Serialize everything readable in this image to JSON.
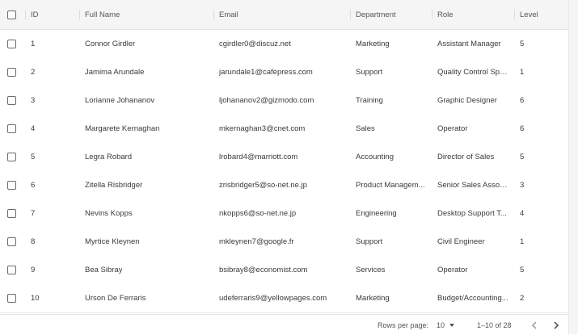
{
  "columns": {
    "id": "ID",
    "name": "Full Name",
    "email": "Email",
    "department": "Department",
    "role": "Role",
    "level": "Level"
  },
  "rows": [
    {
      "id": "1",
      "name": "Connor Girdler",
      "email": "cgirdler0@discuz.net",
      "department": "Marketing",
      "role": "Assistant Manager",
      "level": "5"
    },
    {
      "id": "2",
      "name": "Jamima Arundale",
      "email": "jarundale1@cafepress.com",
      "department": "Support",
      "role": "Quality Control Spe...",
      "level": "1"
    },
    {
      "id": "3",
      "name": "Lorianne Johananov",
      "email": "ljohananov2@gizmodo.com",
      "department": "Training",
      "role": "Graphic Designer",
      "level": "6"
    },
    {
      "id": "4",
      "name": "Margarete Kernaghan",
      "email": "mkernaghan3@cnet.com",
      "department": "Sales",
      "role": "Operator",
      "level": "6"
    },
    {
      "id": "5",
      "name": "Legra Robard",
      "email": "lrobard4@marriott.com",
      "department": "Accounting",
      "role": "Director of Sales",
      "level": "5"
    },
    {
      "id": "6",
      "name": "Zitella Risbridger",
      "email": "zrisbridger5@so-net.ne.jp",
      "department": "Product Managem...",
      "role": "Senior Sales Associ...",
      "level": "3"
    },
    {
      "id": "7",
      "name": "Nevins Kopps",
      "email": "nkopps6@so-net.ne.jp",
      "department": "Engineering",
      "role": "Desktop Support T...",
      "level": "4"
    },
    {
      "id": "8",
      "name": "Myrtice Kleynen",
      "email": "mkleynen7@google.fr",
      "department": "Support",
      "role": "Civil Engineer",
      "level": "1"
    },
    {
      "id": "9",
      "name": "Bea Sibray",
      "email": "bsibray8@economist.com",
      "department": "Services",
      "role": "Operator",
      "level": "5"
    },
    {
      "id": "10",
      "name": "Urson De Ferraris",
      "email": "udeferraris9@yellowpages.com",
      "department": "Marketing",
      "role": "Budget/Accounting...",
      "level": "2"
    }
  ],
  "footer": {
    "rows_per_page_label": "Rows per page:",
    "rows_per_page_value": "10",
    "range": "1–10 of 28",
    "prev_icon": "chevron-left-icon",
    "next_icon": "chevron-right-icon"
  },
  "colors": {
    "header_bg": "#f5f5f5",
    "border": "#ebebeb",
    "text": "#3a3a3a"
  }
}
